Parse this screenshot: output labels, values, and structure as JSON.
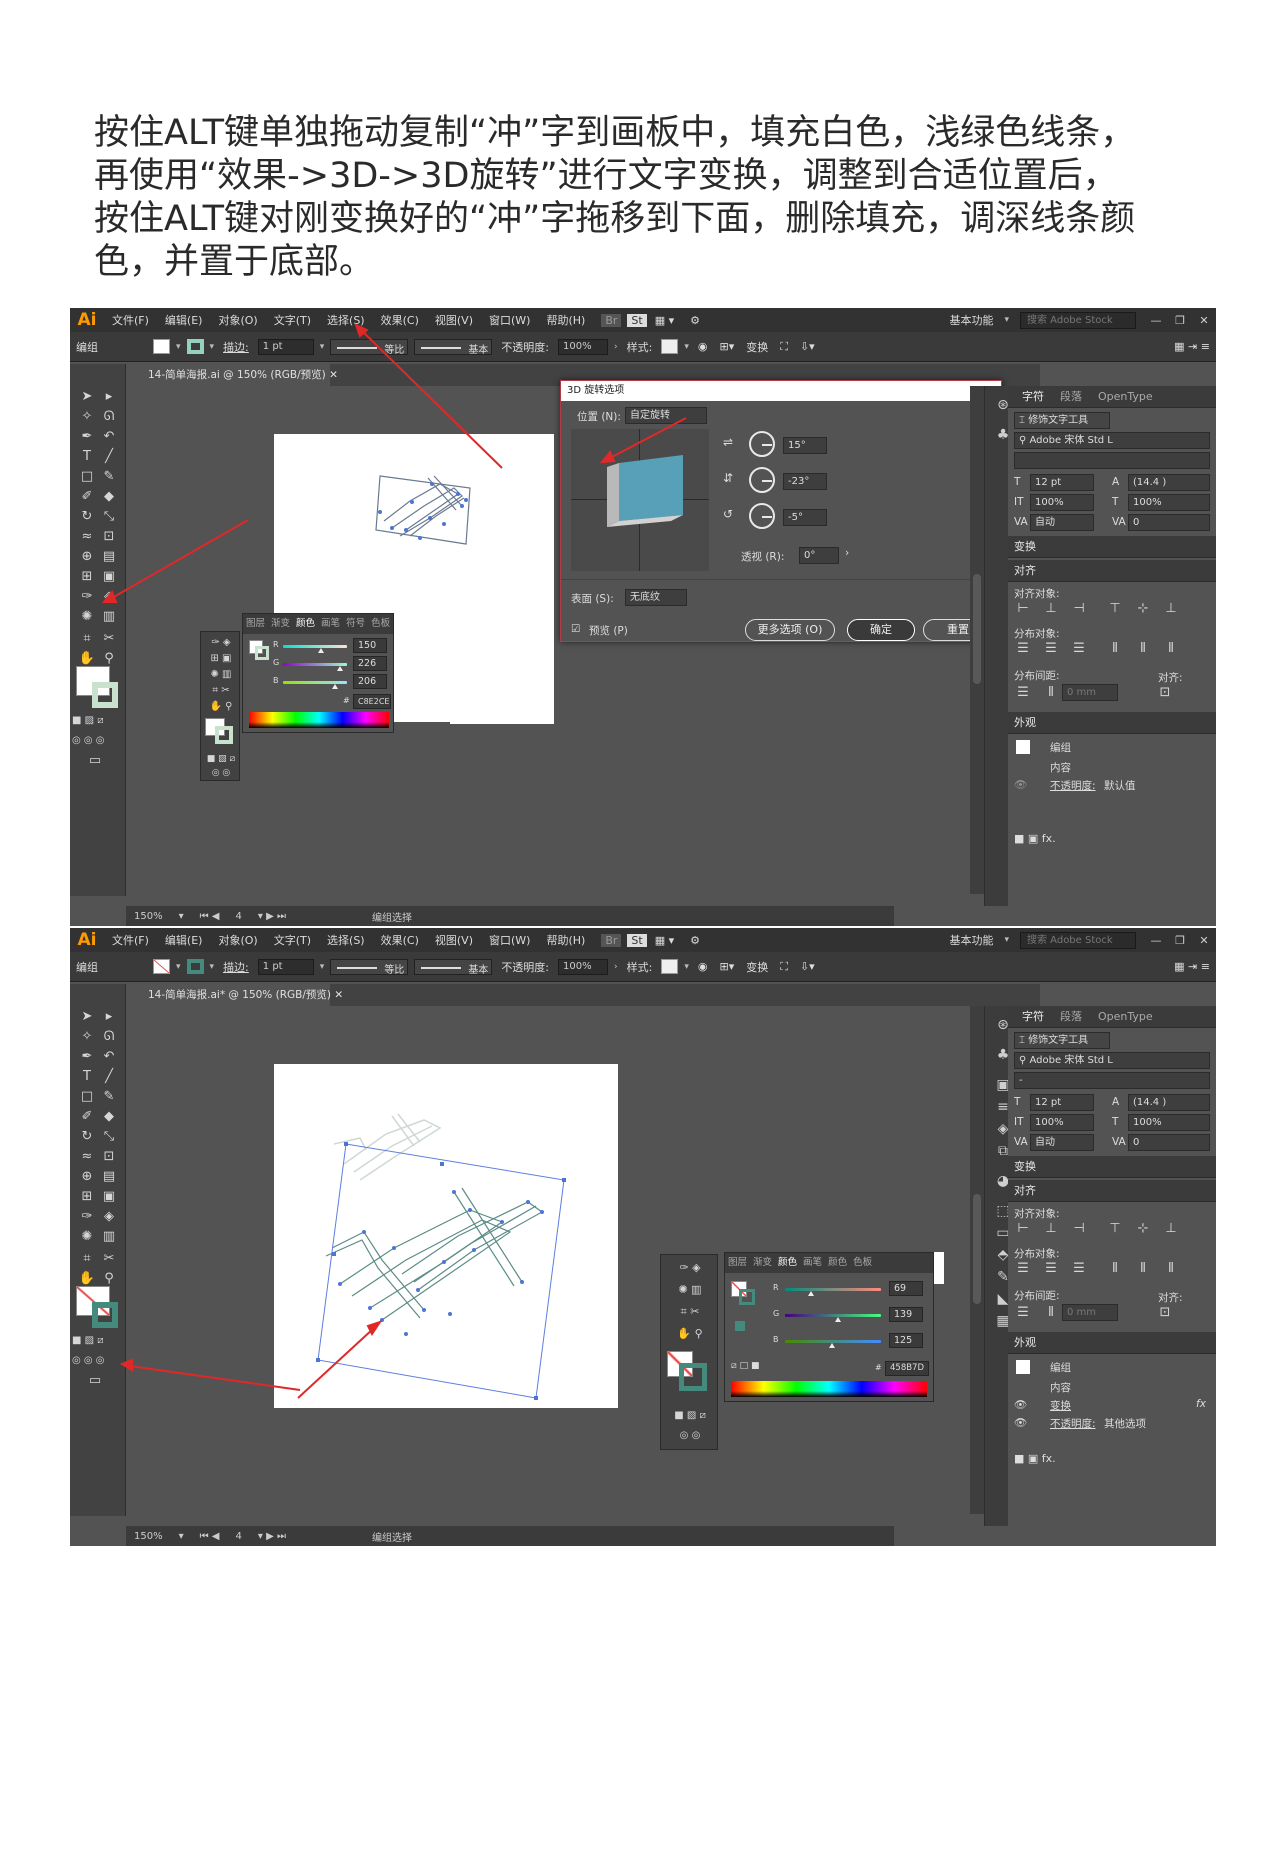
{
  "instruction": {
    "lines": [
      "按住ALT键单独拖动复制“冲”字到画板中，填充白色，浅绿色线条，",
      "再使用“效果->3D->3D旋转”进行文字变换，调整到合适位置后，",
      "按住ALT键对刚变换好的“冲”字拖移到下面，删除填充，调深线条颜",
      "色，并置于底部。"
    ]
  },
  "app": {
    "logo": "Ai",
    "menu": [
      "文件(F)",
      "编辑(E)",
      "对象(O)",
      "文字(T)",
      "选择(S)",
      "效果(C)",
      "视图(V)",
      "窗口(W)",
      "帮助(H)"
    ],
    "workspace": "基本功能",
    "search_placeholder": "搜索 Adobe Stock",
    "br": "Br",
    "st": "St"
  },
  "control": {
    "group_label": "编组",
    "stroke_label": "描边:",
    "stroke_weight": "1 pt",
    "profile1": "等比",
    "profile2": "基本",
    "opacity_label": "不透明度:",
    "opacity": "100%",
    "style_label": "样式:",
    "transform_label": "变换"
  },
  "colors": {
    "light_green": "#96D1BE",
    "dark_teal": "#458B7D",
    "accent_red": "#E02828"
  },
  "shot1": {
    "doc_tab": "14-简单海报.ai @ 150% (RGB/预览)",
    "zoom": "150%",
    "page": "4",
    "status_text": "编组选择",
    "dialog": {
      "title": "3D 旋转选项",
      "position_label": "位置 (N):",
      "position_value": "自定旋转",
      "x_angle": "15°",
      "y_angle": "-23°",
      "z_angle": "-5°",
      "perspective_label": "透视 (R):",
      "perspective_value": "0°",
      "surface_label": "表面 (S):",
      "surface_value": "无底纹",
      "preview_label": "预览 (P)",
      "more_options": "更多选项 (O)",
      "ok": "确定",
      "reset": "重置"
    },
    "color_panel": {
      "tabs": [
        "图层",
        "渐变",
        "颜色",
        "画笔",
        "符号",
        "色板"
      ],
      "r": "150",
      "g": "226",
      "b": "206",
      "r_level": 0.59,
      "g_level": 0.89,
      "b_level": 0.81,
      "hex": "C8E2CE"
    }
  },
  "shot2": {
    "doc_tab": "14-简单海报.ai* @ 150% (RGB/预览)",
    "zoom": "150%",
    "page": "4",
    "status_text": "编组选择",
    "color_panel": {
      "tabs": [
        "图层",
        "渐变",
        "颜色",
        "画笔",
        "颜色",
        "色板"
      ],
      "r": "69",
      "g": "139",
      "b": "125",
      "r_level": 0.27,
      "g_level": 0.55,
      "b_level": 0.49,
      "hex": "458B7D"
    }
  },
  "char_panel": {
    "tabs": [
      "字符",
      "段落",
      "OpenType"
    ],
    "touch_tool": "修饰文字工具",
    "font_family": "Adobe 宋体 Std L",
    "font_style": "-",
    "font_size": "12 pt",
    "leading": "(14.4 )",
    "vscale": "100%",
    "hscale": "100%",
    "kerning": "自动",
    "tracking": "0"
  },
  "transform_panel": {
    "title": "变换"
  },
  "align_panel": {
    "title": "对齐",
    "align_objects": "对齐对象:",
    "distribute_objects": "分布对象:",
    "distribute_spacing": "分布间距:",
    "align_to": "对齐:",
    "spacing_value": "0 mm"
  },
  "appearance1": {
    "title": "外观",
    "group": "编组",
    "content": "内容",
    "opacity_label": "不透明度:",
    "opacity_value": "默认值"
  },
  "appearance2": {
    "title": "外观",
    "group": "编组",
    "content": "内容",
    "transform": "变换",
    "opacity_label": "不透明度:",
    "opacity_value": "其他选项"
  }
}
